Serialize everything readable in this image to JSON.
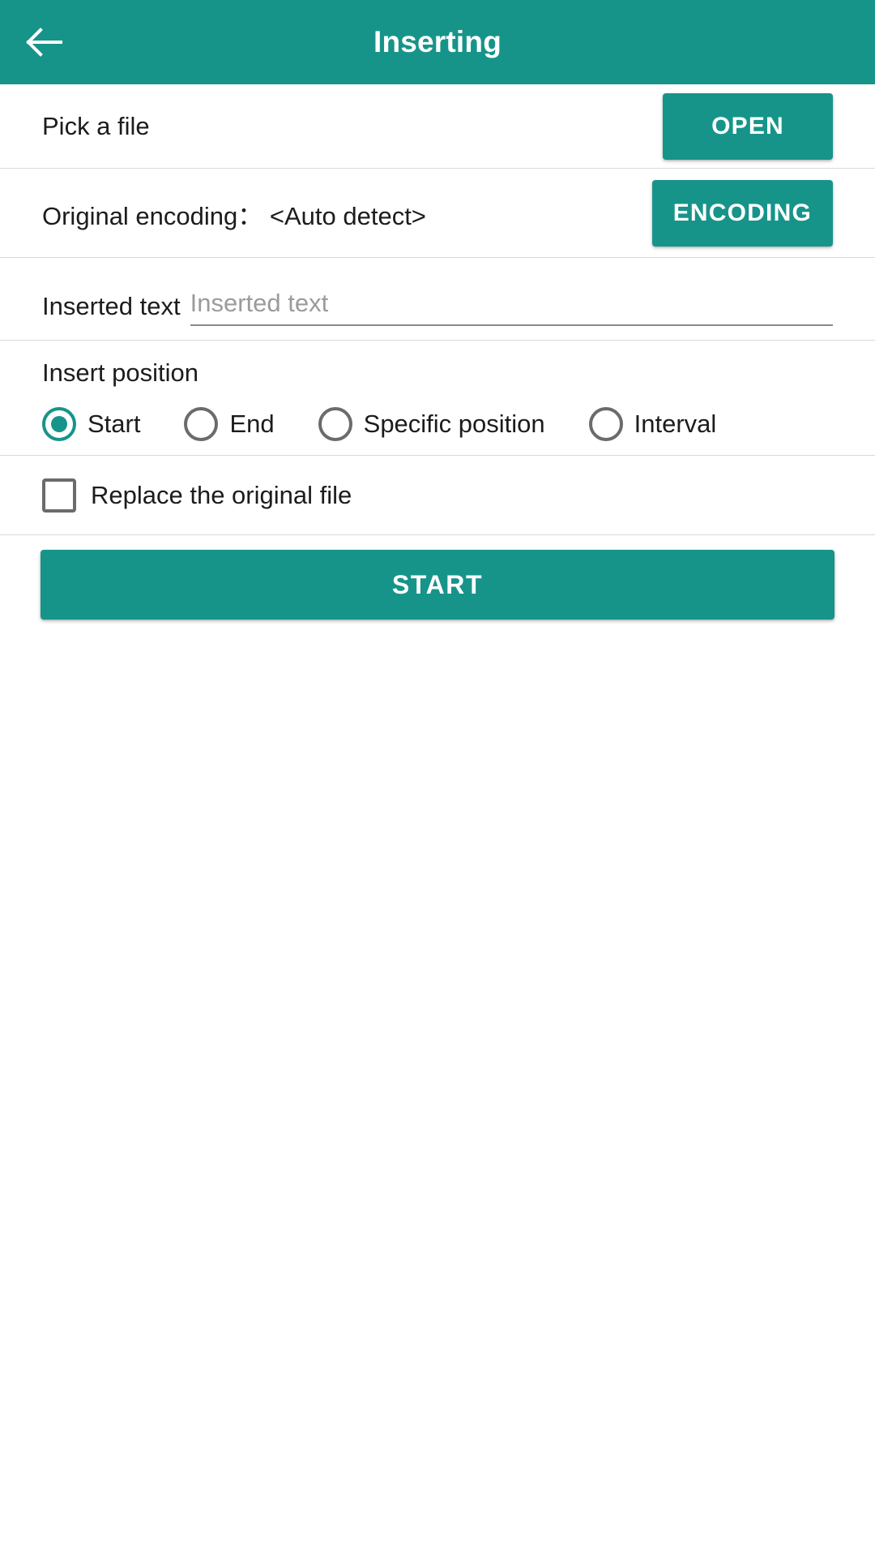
{
  "appbar": {
    "title": "Inserting",
    "back_icon": "arrow-left-icon",
    "background_color": "#17948A",
    "title_color": "#FFFFFF"
  },
  "rows": {
    "pick_file": {
      "label": "Pick a file",
      "button_label": "OPEN"
    },
    "encoding": {
      "label": "Original encoding：",
      "value": "<Auto detect>",
      "display": "Original encoding： <Auto detect>",
      "button_label": "ENCODING"
    },
    "inserted_text": {
      "label": "Inserted text",
      "placeholder": "Inserted text",
      "value": ""
    },
    "insert_position": {
      "title": "Insert position",
      "selected": "Start",
      "options": [
        {
          "label": "Start",
          "checked": true
        },
        {
          "label": "End",
          "checked": false
        },
        {
          "label": "Specific position",
          "checked": false
        },
        {
          "label": "Interval",
          "checked": false
        }
      ]
    },
    "replace_original": {
      "label": "Replace the original file",
      "checked": false
    }
  },
  "start_button": {
    "label": "START"
  },
  "colors": {
    "accent": "#17948A",
    "text": "#1C1C1C",
    "placeholder": "#9B9B9B",
    "divider": "#D9D9D9",
    "control_outline": "#6B6B6B"
  }
}
